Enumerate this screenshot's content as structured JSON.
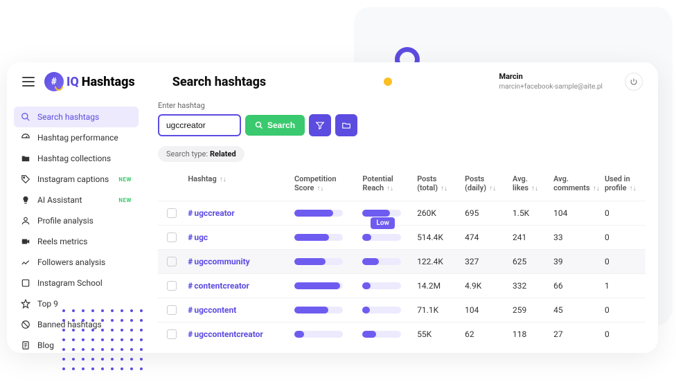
{
  "brand": {
    "iq": "IQ",
    "name": "Hashtags"
  },
  "page_title": "Search hashtags",
  "user": {
    "name": "Marcin",
    "email": "marcin+facebook-sample@aite.pl"
  },
  "sidebar": {
    "items": [
      {
        "label": "Search hashtags",
        "icon": "search",
        "new": false,
        "active": true
      },
      {
        "label": "Hashtag performance",
        "icon": "gauge",
        "new": false
      },
      {
        "label": "Hashtag collections",
        "icon": "folder",
        "new": false
      },
      {
        "label": "Instagram captions",
        "icon": "tag",
        "new": true
      },
      {
        "label": "AI Assistant",
        "icon": "bulb",
        "new": true
      },
      {
        "label": "Profile analysis",
        "icon": "user",
        "new": false
      },
      {
        "label": "Reels metrics",
        "icon": "video",
        "new": false
      },
      {
        "label": "Followers analysis",
        "icon": "chart",
        "new": false
      },
      {
        "label": "Instagram School",
        "icon": "school",
        "new": false
      },
      {
        "label": "Top 9",
        "icon": "star",
        "new": false
      },
      {
        "label": "Banned hashtags",
        "icon": "ban",
        "new": false
      },
      {
        "label": "Blog",
        "icon": "doc",
        "new": false
      }
    ]
  },
  "search": {
    "label": "Enter hashtag",
    "value": "ugccreator",
    "button": "Search",
    "type_prefix": "Search type:",
    "type_value": "Related"
  },
  "columns": {
    "hashtag": "Hashtag",
    "competition": "Competition Score",
    "reach": "Potential Reach",
    "posts_total": "Posts (total)",
    "posts_daily": "Posts (daily)",
    "likes": "Avg. likes",
    "comments": "Avg. comments",
    "used": "Used in profile"
  },
  "tooltip": "Low",
  "rows": [
    {
      "tag": "ugccreator",
      "comp": 80,
      "reach": 70,
      "posts": "260K",
      "daily": "695",
      "likes": "1.5K",
      "comments": "104",
      "used": "0"
    },
    {
      "tag": "ugc",
      "comp": 72,
      "reach": 22,
      "reach_tooltip": true,
      "posts": "514.4K",
      "daily": "474",
      "likes": "241",
      "comments": "33",
      "used": "0"
    },
    {
      "tag": "ugccommunity",
      "comp": 65,
      "reach": 42,
      "posts": "122.4K",
      "daily": "327",
      "likes": "625",
      "comments": "39",
      "used": "0",
      "hover": true
    },
    {
      "tag": "contentcreator",
      "comp": 95,
      "reach": 20,
      "posts": "14.2M",
      "daily": "4.9K",
      "likes": "332",
      "comments": "66",
      "used": "1"
    },
    {
      "tag": "ugccontent",
      "comp": 70,
      "reach": 18,
      "posts": "71.1K",
      "daily": "104",
      "likes": "259",
      "comments": "45",
      "used": "0"
    },
    {
      "tag": "ugccontentcreator",
      "comp": 20,
      "reach": 35,
      "posts": "55K",
      "daily": "62",
      "likes": "118",
      "comments": "27",
      "used": "0"
    }
  ],
  "new_badge": "NEW"
}
